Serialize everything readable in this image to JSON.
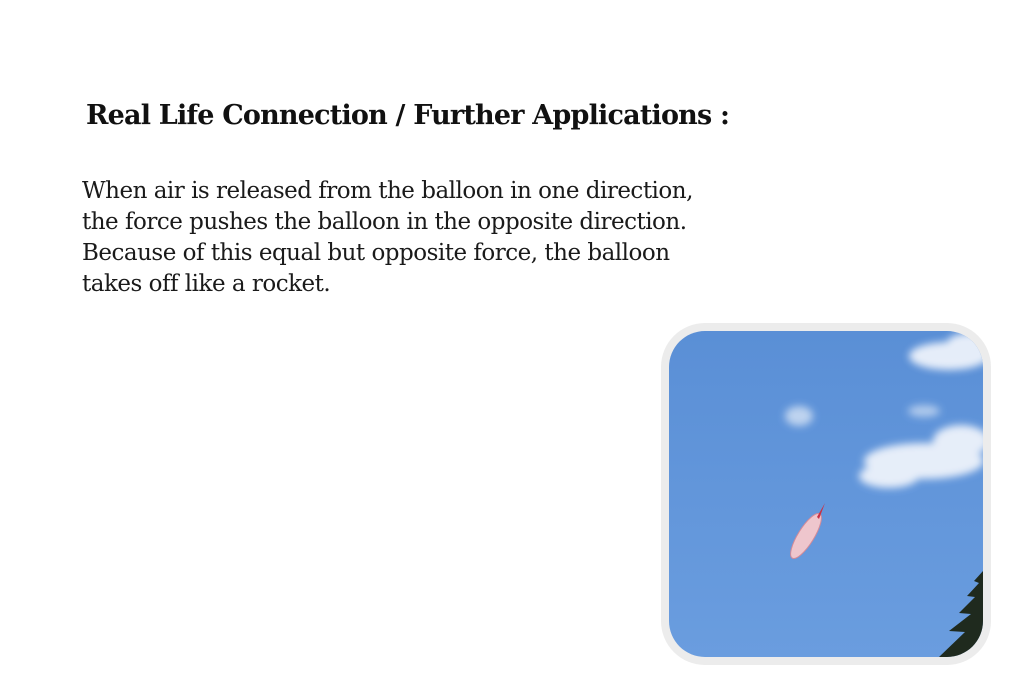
{
  "heading": "Real Life Connection / Further Applications :",
  "paragraph": "When air is released from the balloon in one direction, the force pushes the balloon in the opposite direction. Because of this equal but opposite force, the balloon takes off like a rocket.",
  "photo": {
    "subject": "balloon-in-sky",
    "sky_color": "#5f93d8",
    "balloon_color": "#e8b8c0"
  }
}
